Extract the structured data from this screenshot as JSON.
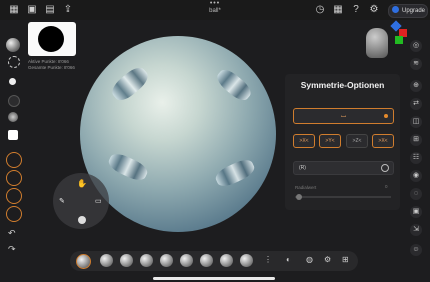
{
  "header": {
    "title_dots": "•••",
    "doc_title": "ball*",
    "upgrade_label": "Upgrade"
  },
  "brush_info": {
    "active_points": "Aktive Punkte: 8'066",
    "total_points": "Gesamte Punkte: 8'066"
  },
  "symmetry_panel": {
    "title": "Symmetrie-Optionen",
    "main_toggle_icon": "symmetry-icon",
    "axis_buttons": [
      {
        "label": ">X<",
        "active": true
      },
      {
        "label": ">Y<",
        "active": true
      },
      {
        "label": ">Z<",
        "active": false
      },
      {
        "label": ">X<",
        "active": true
      }
    ],
    "radial_label": "(R)",
    "slider_label": "Radialwert",
    "slider_value": "0"
  },
  "colors": {
    "accent": "#d07d2e",
    "upgrade_badge": "#2f6fe0"
  }
}
